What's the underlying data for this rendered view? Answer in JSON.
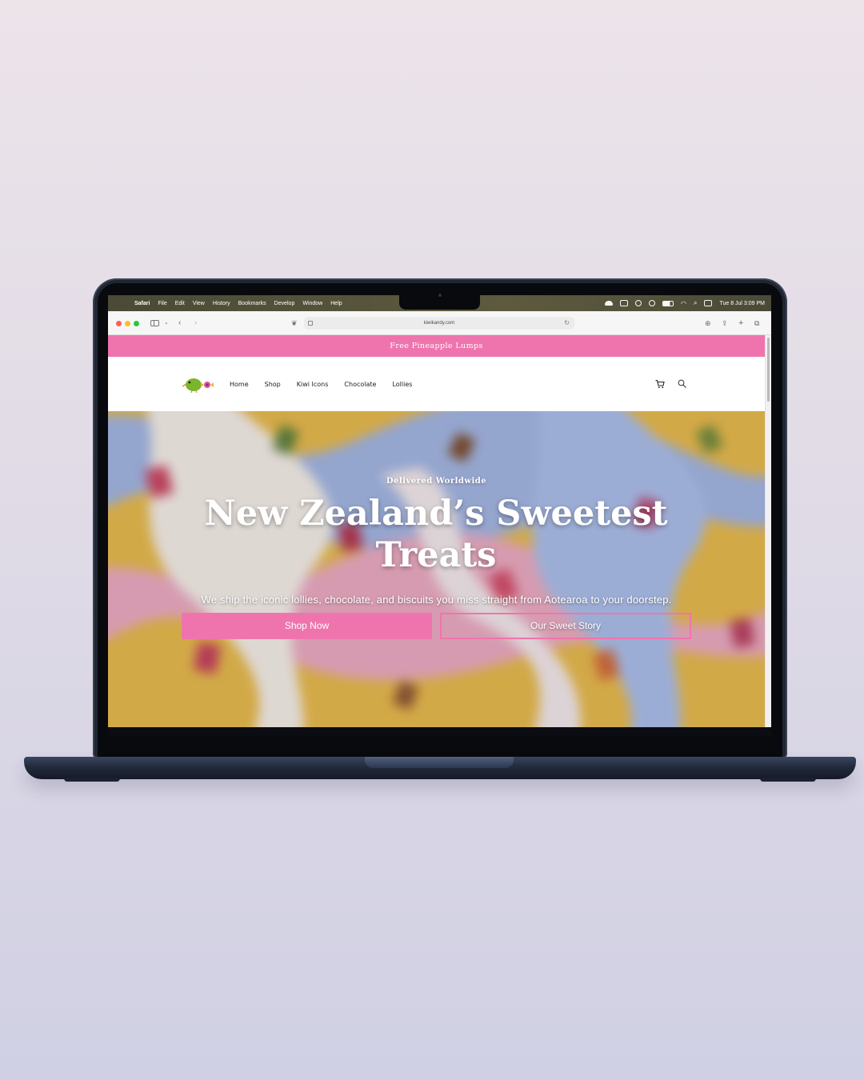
{
  "menubar": {
    "app": "Safari",
    "items": [
      "File",
      "Edit",
      "View",
      "History",
      "Bookmarks",
      "Develop",
      "Window",
      "Help"
    ],
    "clock": "Tue 8 Jul  3:09 PM"
  },
  "browser": {
    "url": "kiwikandy.com"
  },
  "site": {
    "promo": "Free Pineapple Lumps",
    "nav": [
      "Home",
      "Shop",
      "Kiwi Icons",
      "Chocolate",
      "Lollies"
    ],
    "hero": {
      "eyebrow": "Delivered Worldwide",
      "title": "New Zealand’s Sweetest Treats",
      "subtitle": "We ship the iconic lollies, chocolate, and biscuits you miss straight from Aotearoa to your doorstep.",
      "primary_cta": "Shop Now",
      "secondary_cta": "Our Sweet Story"
    }
  },
  "colors": {
    "accent_pink": "#ef74ae",
    "laptop": "#1f2633",
    "menubar": "#55533a"
  },
  "icons": [
    "apple-icon",
    "sidebar-icon",
    "back-icon",
    "forward-icon",
    "share-icon",
    "new-tab-icon",
    "tabs-icon",
    "download-icon",
    "cart-icon",
    "search-icon",
    "kiwi-logo"
  ]
}
